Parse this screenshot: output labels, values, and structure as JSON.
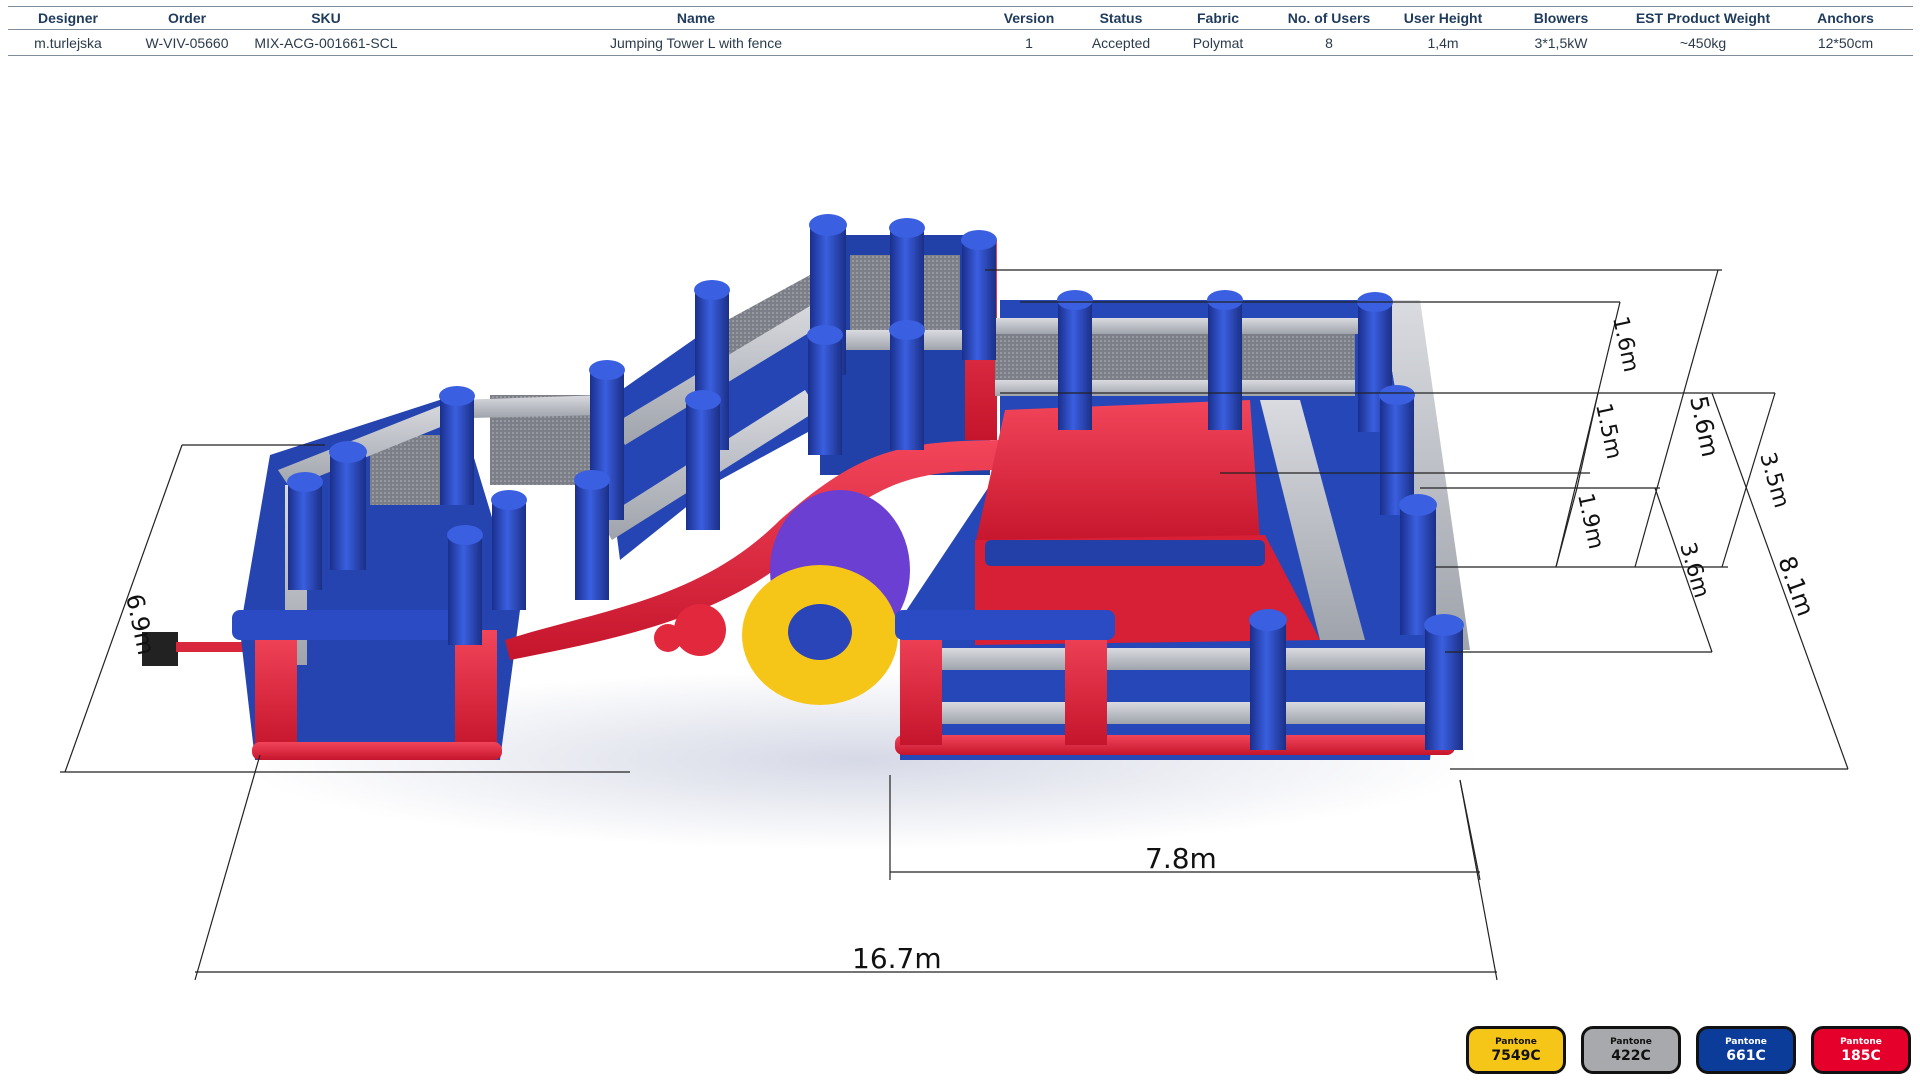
{
  "spec_table": {
    "headers": [
      "Designer",
      "Order",
      "SKU",
      "Name",
      "Version",
      "Status",
      "Fabric",
      "No. of Users",
      "User  Height",
      "Blowers",
      "EST Product Weight",
      "Anchors"
    ],
    "row": [
      "m.turlejska",
      "W-VIV-05660",
      "MIX-ACG-001661-SCL",
      "Jumping Tower L with fence",
      "1",
      "Accepted",
      "Polymat",
      "8",
      "1,4m",
      "3*1,5kW",
      "~450kg",
      "12*50cm"
    ]
  },
  "dimensions": {
    "total_length": "16.7m",
    "section_length": "7.8m",
    "width": "6.9m",
    "height_1": "1.6m",
    "height_2": "1.5m",
    "height_3": "1.9m",
    "height_total": "5.6m",
    "height_right": "3.5m",
    "height_wall": "3.6m",
    "height_overall": "8.1m"
  },
  "pantone": [
    {
      "brand": "Pantone",
      "code": "7549C",
      "color": "#f5c518",
      "text": "#111111"
    },
    {
      "brand": "Pantone",
      "code": "422C",
      "color": "#a7a9ac",
      "text": "#111111"
    },
    {
      "brand": "Pantone",
      "code": "661C",
      "color": "#0b3c99",
      "text": "#ffffff"
    },
    {
      "brand": "Pantone",
      "code": "185C",
      "color": "#e4002b",
      "text": "#ffffff"
    }
  ],
  "colors": {
    "blue": "#2346b8",
    "red": "#e2283d",
    "grey": "#b9bcc2",
    "yellow": "#f5c518",
    "mesh": "#8d8f96"
  }
}
